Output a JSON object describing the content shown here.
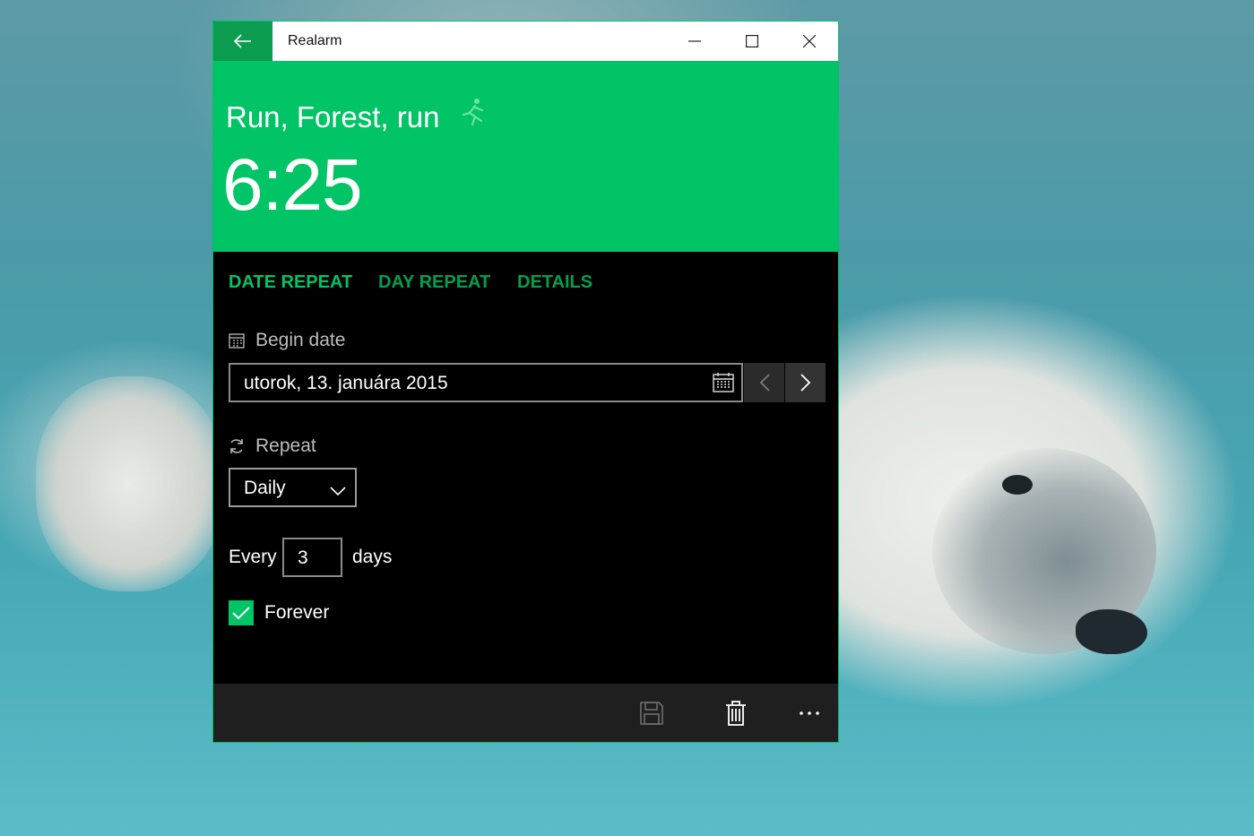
{
  "colors": {
    "accent": "#00c465",
    "accent_dark": "#0c9c4f",
    "tab_active": "#00c465",
    "tab_inactive": "#00a050",
    "window_bg": "#000000",
    "appbar_bg": "#1f1f1f"
  },
  "titlebar": {
    "title": "Realarm",
    "back_icon": "back-arrow-icon",
    "minimize_icon": "minimize-icon",
    "maximize_icon": "maximize-icon",
    "close_icon": "close-icon"
  },
  "alarm": {
    "name": "Run, Forest, run",
    "name_icon": "runner-icon",
    "time": "6:25"
  },
  "tabs": [
    {
      "label": "DATE REPEAT",
      "active": true
    },
    {
      "label": "DAY REPEAT",
      "active": false
    },
    {
      "label": "DETAILS",
      "active": false
    }
  ],
  "begin_date": {
    "label": "Begin date",
    "icon": "calendar-icon",
    "value": "utorok, 13. januára 2015",
    "picker_icon": "calendar-icon",
    "prev_icon": "chevron-left-icon",
    "next_icon": "chevron-right-icon"
  },
  "repeat": {
    "label": "Repeat",
    "icon": "refresh-icon",
    "selected": "Daily"
  },
  "interval": {
    "prefix": "Every",
    "value": "3",
    "suffix": "days"
  },
  "forever": {
    "label": "Forever",
    "checked": true
  },
  "appbar": {
    "save_icon": "save-icon",
    "delete_icon": "delete-icon",
    "more_icon": "more-icon"
  }
}
